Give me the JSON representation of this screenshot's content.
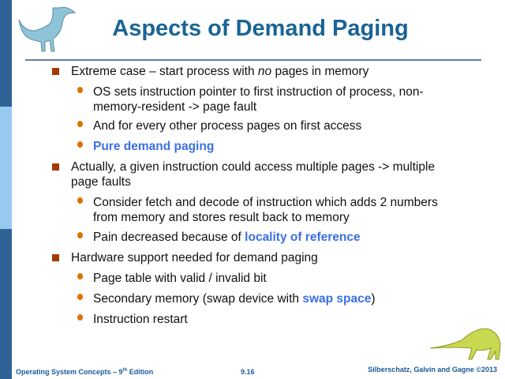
{
  "title": "Aspects of Demand Paging",
  "bullets": [
    {
      "text_a": "Extreme case – start process with ",
      "em": "no",
      "text_b": " pages in memory"
    },
    {
      "text": "OS sets instruction pointer to first instruction of process, non-",
      "text2": "memory-resident -> page fault"
    },
    {
      "text": "And for every other process pages on first access"
    },
    {
      "text": "Pure demand paging"
    },
    {
      "text": "Actually, a given instruction could access multiple pages -> multiple",
      "text2": "page faults"
    },
    {
      "text": "Consider fetch and decode of instruction which adds 2 numbers",
      "text2": "from memory and stores result back to memory"
    },
    {
      "text": "Pain decreased because of ",
      "hl": "locality of reference"
    },
    {
      "text": "Hardware support needed for demand paging"
    },
    {
      "text": "Page table with valid / invalid bit"
    },
    {
      "text": "Secondary memory (swap device with ",
      "hl": "swap space",
      "text_b": ")"
    },
    {
      "text": "Instruction restart"
    }
  ],
  "footer": {
    "left": "Operating System Concepts – 9",
    "sup": "th",
    "left_b": " Edition",
    "center": "9.16",
    "right": "Silberschatz, Galvin and Gagne ©2013"
  }
}
